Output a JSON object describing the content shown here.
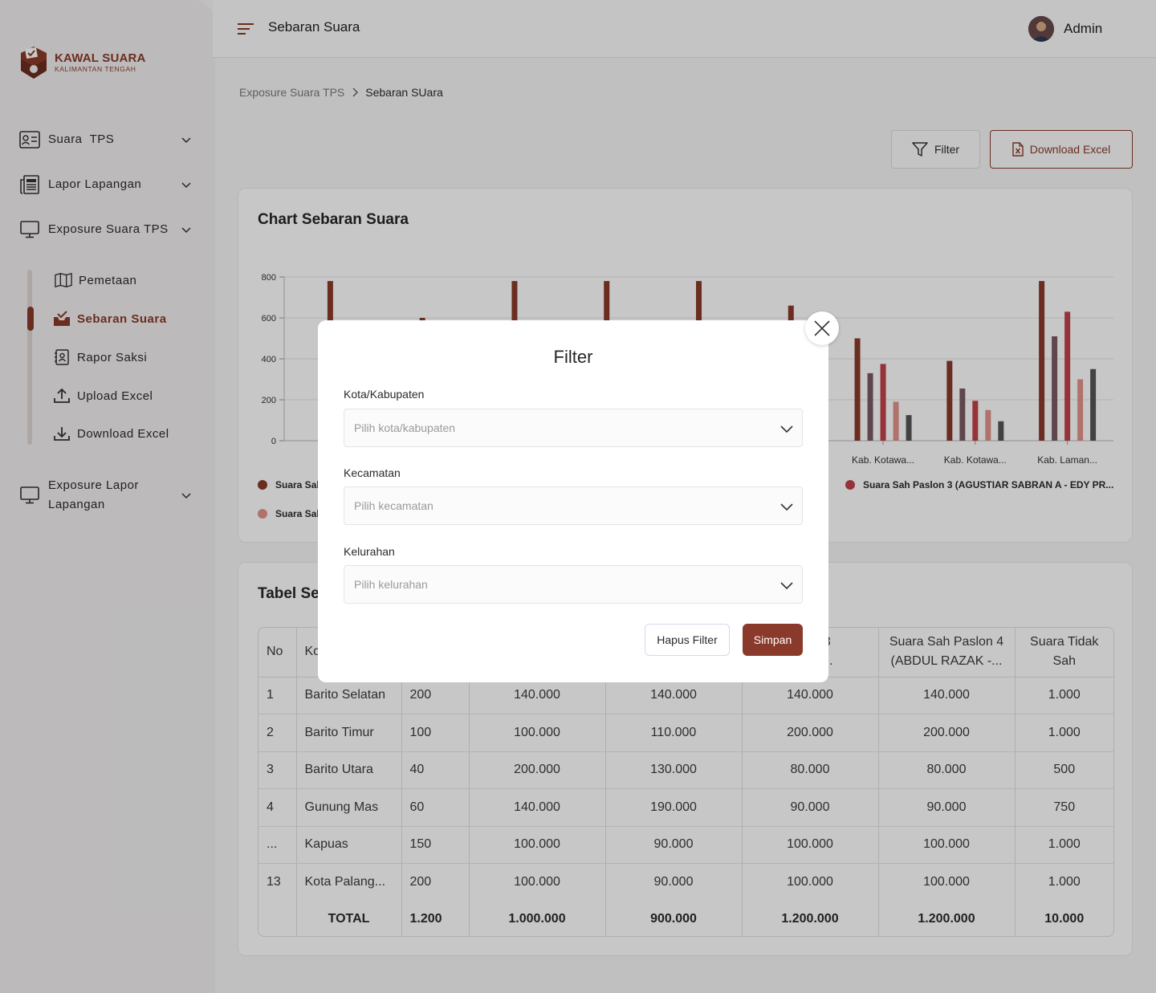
{
  "brand": {
    "title": "KAWAL SUARA",
    "subtitle": "KALIMANTAN TENGAH",
    "color": "#8a3a2a"
  },
  "sidebar": {
    "items": [
      {
        "label": "Suara  TPS",
        "icon": "id-card-icon"
      },
      {
        "label": "Lapor Lapangan",
        "icon": "newspaper-icon"
      },
      {
        "label": "Exposure Suara TPS",
        "icon": "monitor-icon"
      },
      {
        "label": "Exposure Lapor\nLapangan",
        "icon": "monitor-icon"
      }
    ],
    "subitems": [
      {
        "label": "Pemetaan",
        "icon": "map-icon",
        "active": false
      },
      {
        "label": "Sebaran Suara",
        "icon": "inbox-check-icon",
        "active": true
      },
      {
        "label": "Rapor Saksi",
        "icon": "contact-icon",
        "active": false
      },
      {
        "label": "Upload Excel",
        "icon": "upload-icon",
        "active": false
      },
      {
        "label": "Download Excel",
        "icon": "download-icon",
        "active": false
      }
    ]
  },
  "header": {
    "title": "Sebaran Suara",
    "user": "Admin"
  },
  "breadcrumb": {
    "parent": "Exposure Suara TPS",
    "current": "Sebaran SUara"
  },
  "actions": {
    "filter": "Filter",
    "download": "Download Excel"
  },
  "chart_card": {
    "title": "Chart Sebaran Suara"
  },
  "chart_data": {
    "type": "bar",
    "title": "Chart Sebaran Suara",
    "ylim": [
      0,
      800
    ],
    "yticks": [
      "0",
      "200",
      "400",
      "600",
      "800"
    ],
    "grid": true,
    "categories": [
      "",
      "",
      "",
      "",
      "",
      "",
      "Kab. Kotawa...",
      "Kab. Kotawa...",
      "Kab. Laman..."
    ],
    "series": [
      {
        "name": "Suara Sah",
        "color": "#8a3a2a",
        "values": [
          780,
          600,
          780,
          780,
          780,
          660,
          500,
          390,
          780
        ]
      },
      {
        "name": "",
        "color": "#7a5a64",
        "values": [
          null,
          null,
          null,
          null,
          null,
          null,
          330,
          255,
          510
        ]
      },
      {
        "name": "Suara Sah Paslon 3 (AGUSTIAR SABRAN A - EDY PR...",
        "color": "#c0424a",
        "values": [
          null,
          null,
          null,
          null,
          null,
          null,
          375,
          195,
          630
        ]
      },
      {
        "name": "Suara Sah",
        "color": "#e0948a",
        "values": [
          null,
          null,
          null,
          null,
          null,
          null,
          190,
          150,
          300
        ]
      },
      {
        "name": "",
        "color": "#555555",
        "values": [
          null,
          null,
          null,
          null,
          null,
          null,
          125,
          95,
          350
        ]
      }
    ]
  },
  "table": {
    "title": "Tabel Se",
    "headers": [
      "No",
      "Ko",
      "",
      "",
      "",
      "aslon 3\nSABR...",
      "Suara Sah Paslon 4\n(ABDUL RAZAK -...",
      "Suara Tidak\nSah"
    ],
    "rows": [
      [
        "1",
        "Barito Selatan",
        "200",
        "140.000",
        "140.000",
        "140.000",
        "140.000",
        "1.000"
      ],
      [
        "2",
        "Barito Timur",
        "100",
        "100.000",
        "110.000",
        "200.000",
        "200.000",
        "1.000"
      ],
      [
        "3",
        "Barito Utara",
        "40",
        "200.000",
        "130.000",
        "80.000",
        "80.000",
        "500"
      ],
      [
        "4",
        "Gunung Mas",
        "60",
        "140.000",
        "190.000",
        "90.000",
        "90.000",
        "750"
      ],
      [
        "...",
        "Kapuas",
        "150",
        "100.000",
        "90.000",
        "100.000",
        "100.000",
        "1.000"
      ],
      [
        "13",
        "Kota Palang...",
        "200",
        "100.000",
        "90.000",
        "100.000",
        "100.000",
        "1.000"
      ]
    ],
    "total": [
      "TOTAL",
      "1.200",
      "1.000.000",
      "900.000",
      "1.200.000",
      "1.200.000",
      "10.000"
    ]
  },
  "modal": {
    "title": "Filter",
    "fields": [
      {
        "label": "Kota/Kabupaten",
        "placeholder": "Pilih kota/kabupaten"
      },
      {
        "label": "Kecamatan",
        "placeholder": "Pilih kecamatan"
      },
      {
        "label": "Kelurahan",
        "placeholder": "Pilih kelurahan"
      }
    ],
    "clear": "Hapus Filter",
    "save": "Simpan"
  }
}
